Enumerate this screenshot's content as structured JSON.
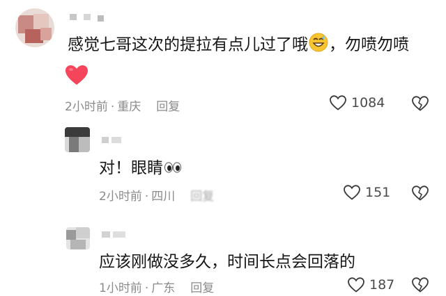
{
  "comments": [
    {
      "text": "感觉七哥这次的提拉有点儿过了哦",
      "text_tail": "，勿喷勿喷",
      "emoji": "sweat-smile-emoji",
      "second_line_emoji": "red-heart-emoji",
      "time": "2小时前",
      "location": "重庆",
      "reply_label": "回复",
      "likes": "1084"
    },
    {
      "text": "对！眼睛",
      "emoji": "eyes-emoji",
      "time": "2小时前",
      "location": "四川",
      "reply_label": "回复",
      "likes": "151"
    },
    {
      "text": "应该刚做没多久，时间长点会回落的",
      "time": "1小时前",
      "location": "广东",
      "reply_label": "回复",
      "likes": "187"
    }
  ],
  "separator": "·",
  "colors": {
    "heart_red": "#f5455a",
    "meta_gray": "#8a8a8a",
    "icon_gray": "#3a3a3a"
  }
}
